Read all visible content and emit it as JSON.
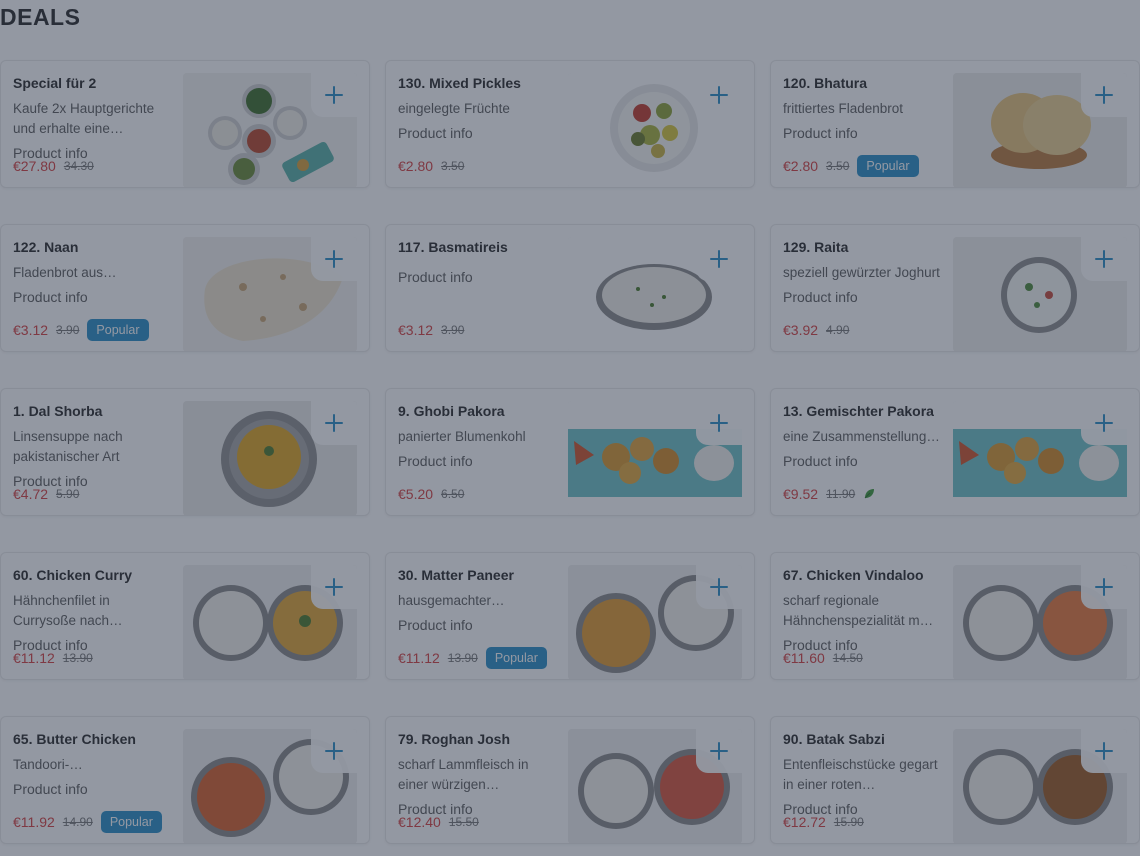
{
  "section_title": "DEALS",
  "product_info_label": "Product info",
  "items": [
    {
      "title": "Special für 2",
      "description": "Kaufe 2x Hauptgerichte und erhalte eine…",
      "price": "€27.80",
      "old_price": "34.30",
      "badge": "",
      "image": "thali",
      "vegetarian": false
    },
    {
      "title": "130. Mixed Pickles",
      "description": "eingelegte Früchte",
      "price": "€2.80",
      "old_price": "3.50",
      "badge": "",
      "image": "pickles",
      "vegetarian": false
    },
    {
      "title": "120. Bhatura",
      "description": "frittiertes Fladenbrot",
      "price": "€2.80",
      "old_price": "3.50",
      "badge": "Popular",
      "image": "bhatura",
      "vegetarian": false
    },
    {
      "title": "122. Naan",
      "description": "Fladenbrot aus…",
      "price": "€3.12",
      "old_price": "3.90",
      "badge": "Popular",
      "image": "naan",
      "vegetarian": false
    },
    {
      "title": "117. Basmatireis",
      "description": "",
      "price": "€3.12",
      "old_price": "3.90",
      "badge": "",
      "image": "rice",
      "vegetarian": false
    },
    {
      "title": "129. Raita",
      "description": "speziell gewürzter Joghurt",
      "price": "€3.92",
      "old_price": "4.90",
      "badge": "",
      "image": "raita",
      "vegetarian": false
    },
    {
      "title": "1. Dal Shorba",
      "description": "Linsensuppe nach pakistanischer Art",
      "price": "€4.72",
      "old_price": "5.90",
      "badge": "",
      "image": "soup",
      "vegetarian": false
    },
    {
      "title": "9. Ghobi Pakora",
      "description": "panierter Blumenkohl",
      "price": "€5.20",
      "old_price": "6.50",
      "badge": "",
      "image": "pakora",
      "vegetarian": false
    },
    {
      "title": "13. Gemischter Pakora",
      "description": "eine Zusammenstellung…",
      "price": "€9.52",
      "old_price": "11.90",
      "badge": "",
      "image": "pakora",
      "vegetarian": true
    },
    {
      "title": "60. Chicken Curry",
      "description": "Hähnchenfilet in Currysoße nach…",
      "price": "€11.12",
      "old_price": "13.90",
      "badge": "",
      "image": "curry-yellow",
      "vegetarian": false
    },
    {
      "title": "30. Matter Paneer",
      "description": "hausgemachter…",
      "price": "€11.12",
      "old_price": "13.90",
      "badge": "Popular",
      "image": "curry-yellow-left",
      "vegetarian": false
    },
    {
      "title": "67. Chicken Vindaloo",
      "description": "scharf regionale Hähnchenspezialität m…",
      "price": "€11.60",
      "old_price": "14.50",
      "badge": "",
      "image": "curry-orange",
      "vegetarian": false
    },
    {
      "title": "65. Butter Chicken",
      "description": "Tandoori-…",
      "price": "€11.92",
      "old_price": "14.90",
      "badge": "Popular",
      "image": "curry-red-left",
      "vegetarian": false
    },
    {
      "title": "79. Roghan Josh",
      "description": "scharf Lammfleisch in einer würzigen…",
      "price": "€12.40",
      "old_price": "15.50",
      "badge": "",
      "image": "curry-red",
      "vegetarian": false
    },
    {
      "title": "90. Batak Sabzi",
      "description": "Entenfleischstücke gegart in einer roten…",
      "price": "€12.72",
      "old_price": "15.90",
      "badge": "",
      "image": "curry-dark",
      "vegetarian": false
    }
  ],
  "colors": {
    "accent": "#2a8fc7",
    "price": "#d64141",
    "badge_bg": "#2a8fc7"
  },
  "icons": {
    "add": "plus-icon",
    "vegetarian": "leaf-icon"
  }
}
